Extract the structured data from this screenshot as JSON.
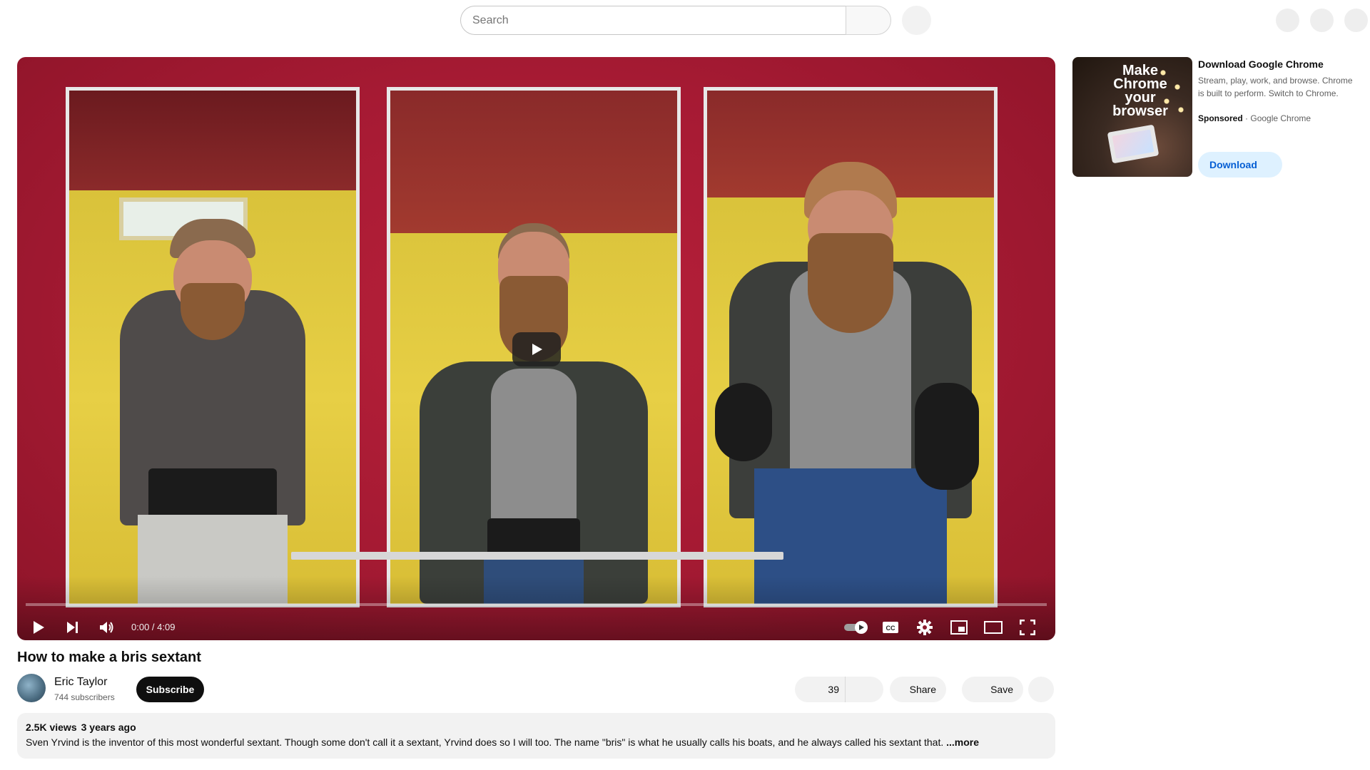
{
  "search": {
    "placeholder": "Search"
  },
  "player": {
    "time_display": "0:00 / 4:09",
    "progress": 0
  },
  "video": {
    "title": "How to make a bris sextant",
    "channel_name": "Eric Taylor",
    "subscribers": "744 subscribers",
    "subscribe_label": "Subscribe",
    "like_count": "39",
    "share_label": "Share",
    "save_label": "Save",
    "views": "2.5K views",
    "age": "3 years ago",
    "description": "Sven Yrvind is the inventor of this most wonderful sextant.  Though some don't call it a sextant, Yrvind does so I will too.  The name \"bris\" is what he usually calls his boats, and he always called his sextant that.",
    "more_label": "...more"
  },
  "ad": {
    "thumbnail_text": "Make Chrome your browser",
    "title": "Download Google Chrome",
    "description": "Stream, play, work, and browse. Chrome is built to perform. Switch to Chrome.",
    "sponsored_label": "Sponsored",
    "advertiser": "Google Chrome",
    "button_label": "Download"
  },
  "icons": [
    "search-icon",
    "mic-icon",
    "play-icon",
    "next-icon",
    "volume-icon",
    "autoplay-toggle-icon",
    "captions-icon",
    "settings-icon",
    "miniplayer-icon",
    "theater-mode-icon",
    "fullscreen-icon"
  ],
  "colors": {
    "player_background": "#a51a33",
    "subscribe_bg": "#0f0f0f",
    "ad_button_bg": "#def1ff",
    "ad_button_text": "#065fd4"
  }
}
